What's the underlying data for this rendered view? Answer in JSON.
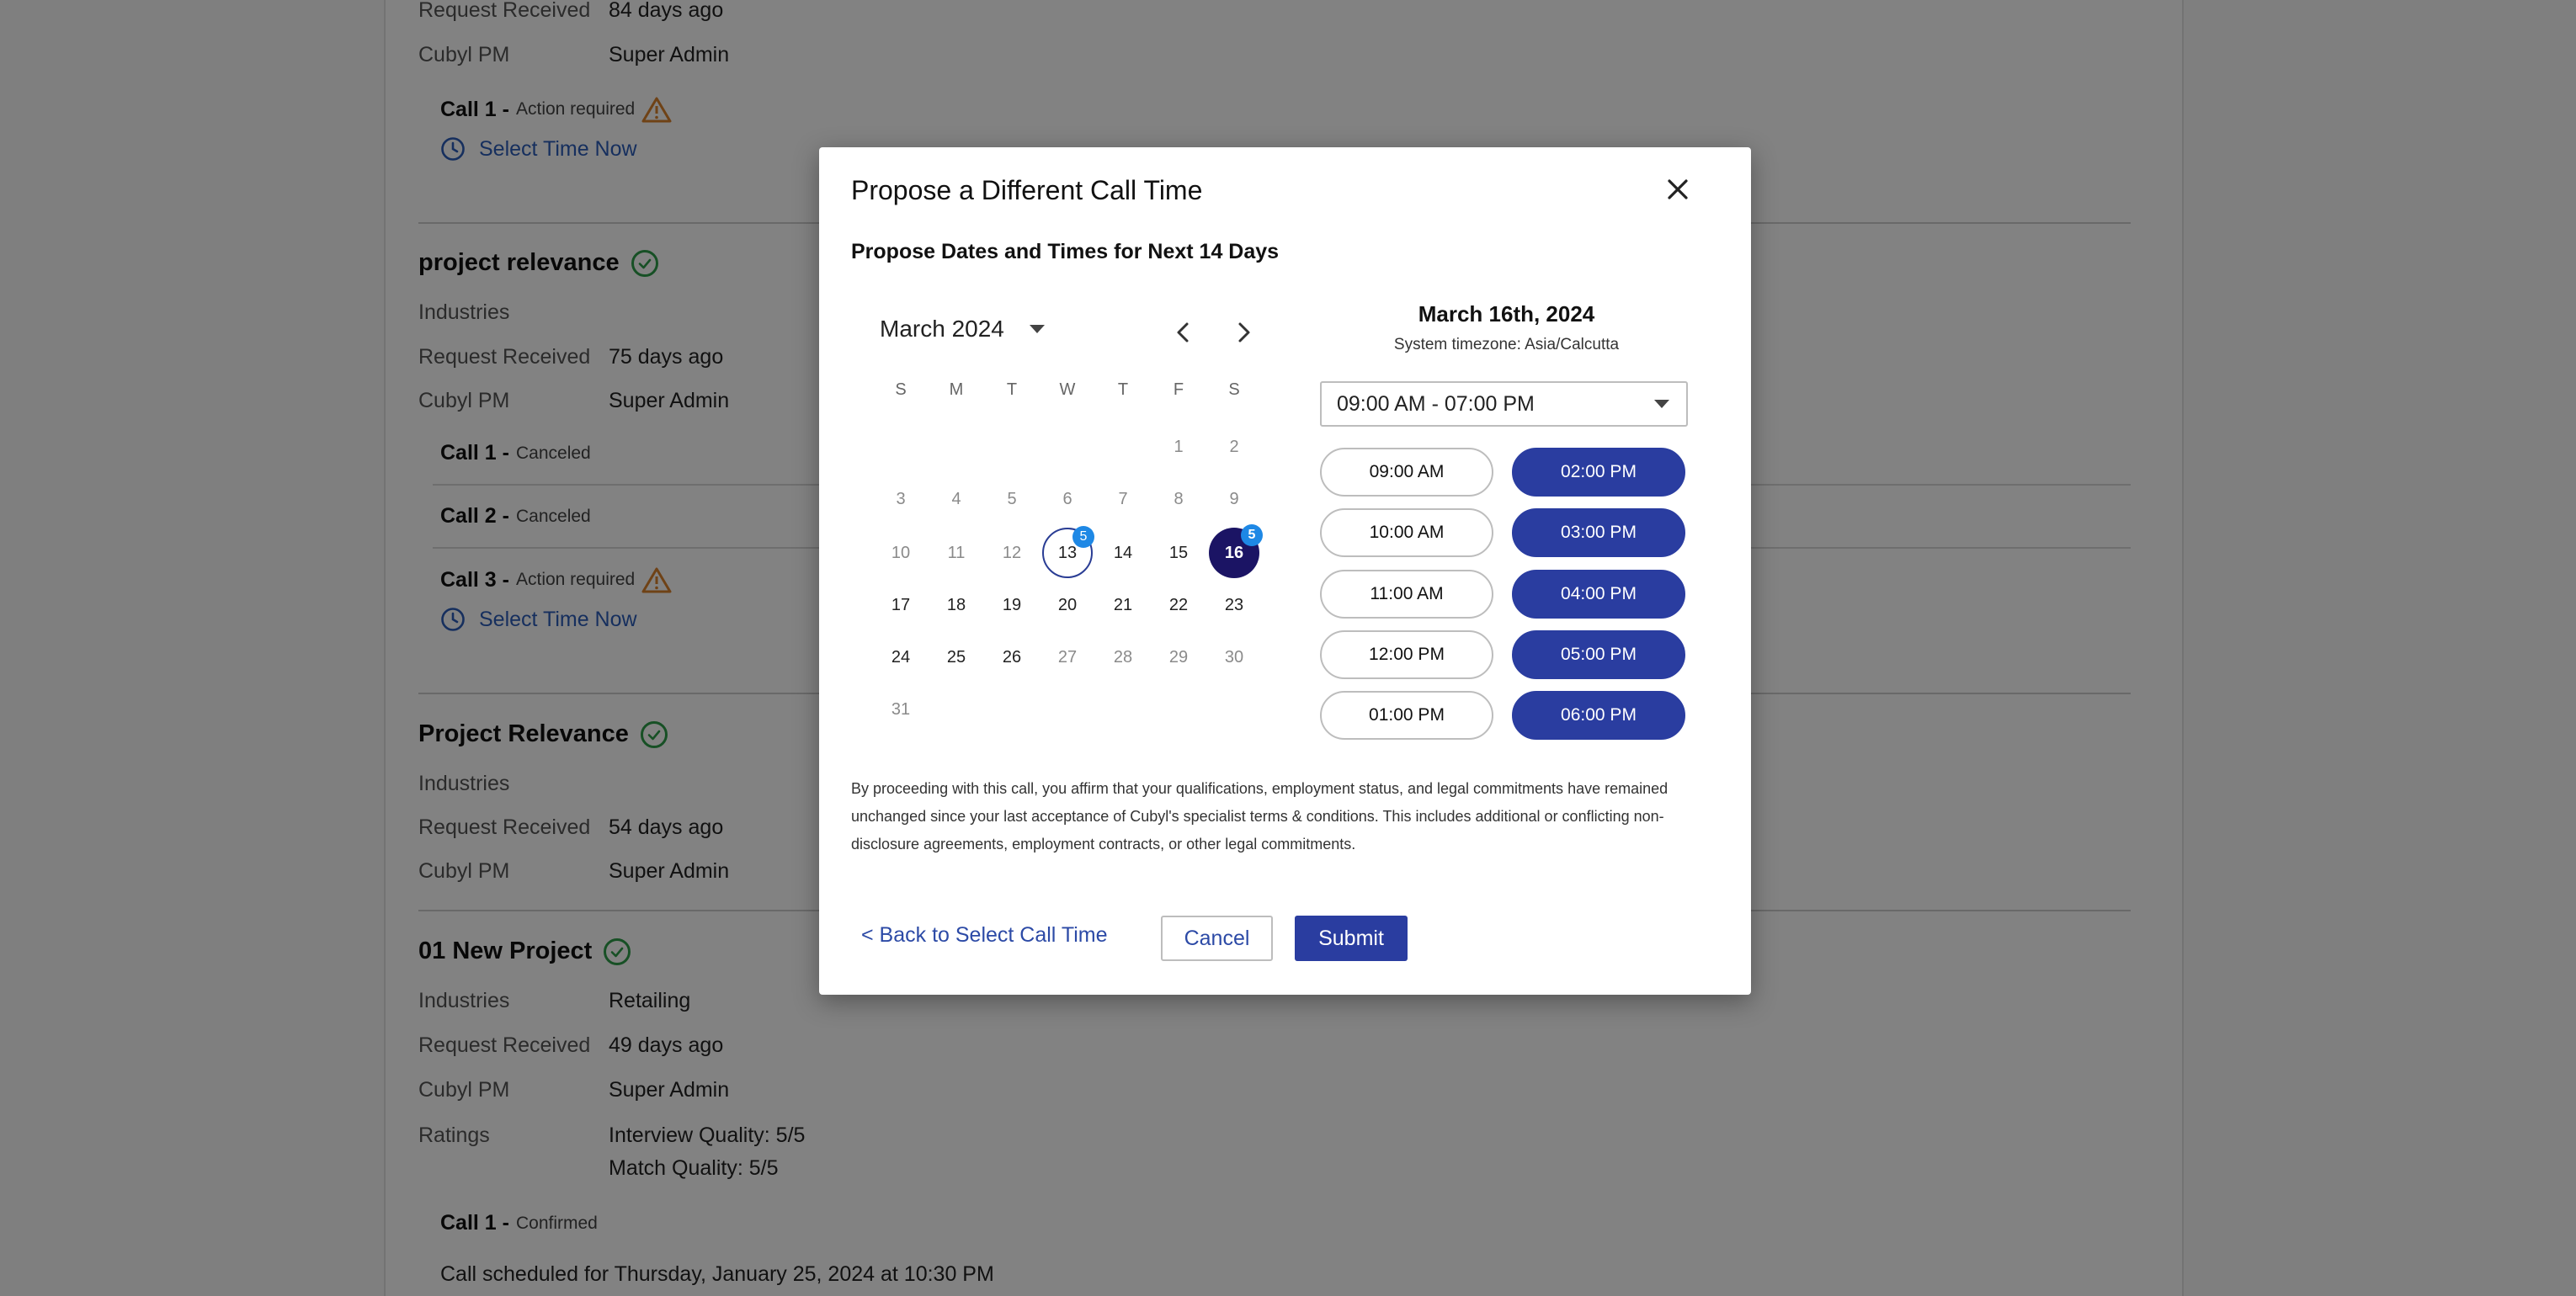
{
  "background": {
    "sections": [
      {
        "rows": [
          {
            "label": "Request Received",
            "value": "84 days ago"
          },
          {
            "label": "Cubyl PM",
            "value": "Super Admin"
          }
        ],
        "calls": [
          {
            "name": "Call 1 -",
            "status": "Action required",
            "action": "Select Time Now"
          }
        ]
      },
      {
        "title": "project relevance",
        "rows": [
          {
            "label": "Industries",
            "value": ""
          },
          {
            "label": "Request Received",
            "value": "75 days ago"
          },
          {
            "label": "Cubyl PM",
            "value": "Super Admin"
          }
        ],
        "calls": [
          {
            "name": "Call 1 -",
            "status": "Canceled"
          },
          {
            "name": "Call 2 -",
            "status": "Canceled"
          },
          {
            "name": "Call 3 -",
            "status": "Action required",
            "action": "Select Time Now"
          }
        ]
      },
      {
        "title": "Project Relevance",
        "rows": [
          {
            "label": "Industries",
            "value": ""
          },
          {
            "label": "Request Received",
            "value": "54 days ago"
          },
          {
            "label": "Cubyl PM",
            "value": "Super Admin"
          }
        ]
      },
      {
        "title": "01 New Project",
        "rows": [
          {
            "label": "Industries",
            "value": "Retailing"
          },
          {
            "label": "Request Received",
            "value": "49 days ago"
          },
          {
            "label": "Cubyl PM",
            "value": "Super Admin"
          },
          {
            "label": "Ratings",
            "value": "Interview Quality: 5/5"
          }
        ],
        "extra_rating": "Match Quality: 5/5",
        "calls": [
          {
            "name": "Call 1 -",
            "status": "Confirmed"
          }
        ],
        "scheduled_text": "Call scheduled for Thursday, January 25, 2024 at 10:30 PM"
      }
    ]
  },
  "modal": {
    "title": "Propose a Different Call Time",
    "subtitle": "Propose Dates and Times for Next 14 Days",
    "calendar": {
      "month_label": "March 2024",
      "weekdays": [
        "S",
        "M",
        "T",
        "W",
        "T",
        "F",
        "S"
      ],
      "weeks": [
        [
          "",
          "",
          "",
          "",
          "",
          "1",
          "2"
        ],
        [
          "3",
          "4",
          "5",
          "6",
          "7",
          "8",
          "9"
        ],
        [
          "10",
          "11",
          "12",
          "13",
          "14",
          "15",
          "16"
        ],
        [
          "17",
          "18",
          "19",
          "20",
          "21",
          "22",
          "23"
        ],
        [
          "24",
          "25",
          "26",
          "27",
          "28",
          "29",
          "30"
        ],
        [
          "31",
          "",
          "",
          "",
          "",
          "",
          ""
        ]
      ],
      "today": "13",
      "selected": "16",
      "badges": {
        "13": "5",
        "16": "5"
      }
    },
    "selected_date_label": "March 16th, 2024",
    "timezone_label": "System timezone: Asia/Calcutta",
    "time_range": "09:00 AM - 07:00 PM",
    "time_slots": [
      {
        "label": "09:00 AM",
        "selected": false
      },
      {
        "label": "02:00 PM",
        "selected": true
      },
      {
        "label": "10:00 AM",
        "selected": false
      },
      {
        "label": "03:00 PM",
        "selected": true
      },
      {
        "label": "11:00 AM",
        "selected": false
      },
      {
        "label": "04:00 PM",
        "selected": true
      },
      {
        "label": "12:00 PM",
        "selected": false
      },
      {
        "label": "05:00 PM",
        "selected": true
      },
      {
        "label": "01:00 PM",
        "selected": false
      },
      {
        "label": "06:00 PM",
        "selected": true
      }
    ],
    "disclaimer": "By proceeding with this call, you affirm that your qualifications, employment status, and legal commitments have remained unchanged since your last acceptance of Cubyl's specialist terms & conditions. This includes additional or conflicting non-disclosure agreements, employment contracts, or other legal commitments.",
    "back_label": "< Back to Select Call Time",
    "cancel_label": "Cancel",
    "submit_label": "Submit"
  },
  "colors": {
    "primary": "#2a3da0",
    "selected_day": "#1b1464",
    "badge": "#1e88e5",
    "success": "#2e9e4a",
    "warning": "#d9822b",
    "link": "#2c5db8"
  },
  "icons": [
    "close-icon",
    "chevron-left-icon",
    "chevron-right-icon",
    "caret-down-icon",
    "check-circle-icon",
    "warning-icon",
    "clock-icon"
  ]
}
